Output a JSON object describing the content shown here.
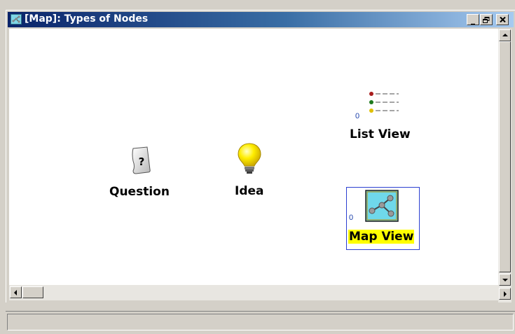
{
  "window": {
    "title": "[Map]: Types of Nodes",
    "buttons": {
      "minimize": "_",
      "restore": "Œ",
      "close": "×"
    }
  },
  "nodes": [
    {
      "id": "question",
      "label": "Question",
      "icon": "question-note-icon"
    },
    {
      "id": "idea",
      "label": "Idea",
      "icon": "lightbulb-icon"
    },
    {
      "id": "list_view",
      "label": "List View",
      "icon": "list-view-icon",
      "count": "0"
    },
    {
      "id": "map_view",
      "label": "Map View",
      "icon": "map-view-icon",
      "count": "0",
      "selected": true
    }
  ],
  "colors": {
    "selection_border": "#2b3fd1",
    "label_highlight": "#ffff00",
    "titlebar_start": "#0a246a",
    "titlebar_end": "#a6caf0"
  }
}
